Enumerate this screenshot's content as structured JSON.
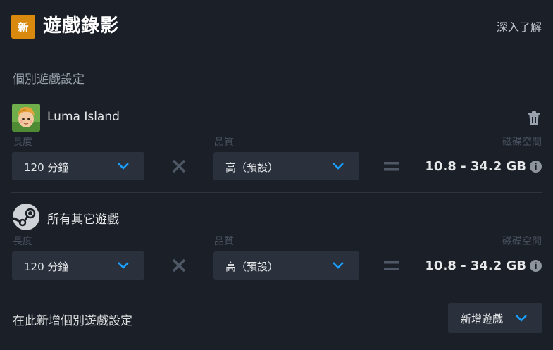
{
  "header": {
    "badge": "新",
    "title": "遊戲錄影",
    "learn_more": "深入了解"
  },
  "section_label": "個別遊戲設定",
  "games": [
    {
      "name": "Luma Island",
      "icon": "luma-island-icon",
      "length_label": "長度",
      "length_value": "120 分鐘",
      "quality_label": "品質",
      "quality_value": "高（預設）",
      "disk_label": "磁碟空間",
      "disk_value": "10.8 - 34.2 GB",
      "has_delete": true
    },
    {
      "name": "所有其它遊戲",
      "icon": "steam-icon",
      "length_label": "長度",
      "length_value": "120 分鐘",
      "quality_label": "品質",
      "quality_value": "高（預設）",
      "disk_label": "磁碟空間",
      "disk_value": "10.8 - 34.2 GB",
      "has_delete": false
    }
  ],
  "add_row": {
    "label": "在此新增個別遊戲設定",
    "button": "新增遊戲"
  },
  "colors": {
    "background": "#1b2028",
    "badge": "#d9890d",
    "accent": "#1a9fff",
    "control": "#2a313c"
  }
}
